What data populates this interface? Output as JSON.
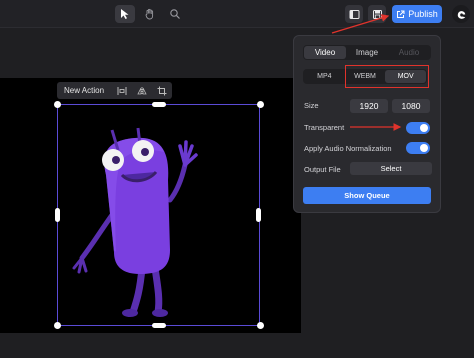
{
  "toolbar": {
    "tools": [
      "pointer-tool",
      "hand-tool",
      "zoom-tool"
    ],
    "publish_label": "Publish"
  },
  "action_bar": {
    "label": "New Action"
  },
  "export_panel": {
    "media_tabs": [
      "Video",
      "Image",
      "Audio"
    ],
    "selected_media": "Video",
    "formats": [
      "MP4",
      "WEBM",
      "MOV"
    ],
    "selected_format": "MOV",
    "size_label": "Size",
    "width": "1920",
    "height": "1080",
    "transparent_label": "Transparent",
    "transparent_on": true,
    "audio_norm_label": "Apply Audio Normalization",
    "audio_norm_on": true,
    "output_label": "Output File",
    "select_label": "Select",
    "show_queue_label": "Show Queue"
  },
  "colors": {
    "accent": "#3d7ef2",
    "annotation": "#e0332c",
    "selection": "#5b4bd6",
    "character": "#7a3fe0"
  }
}
